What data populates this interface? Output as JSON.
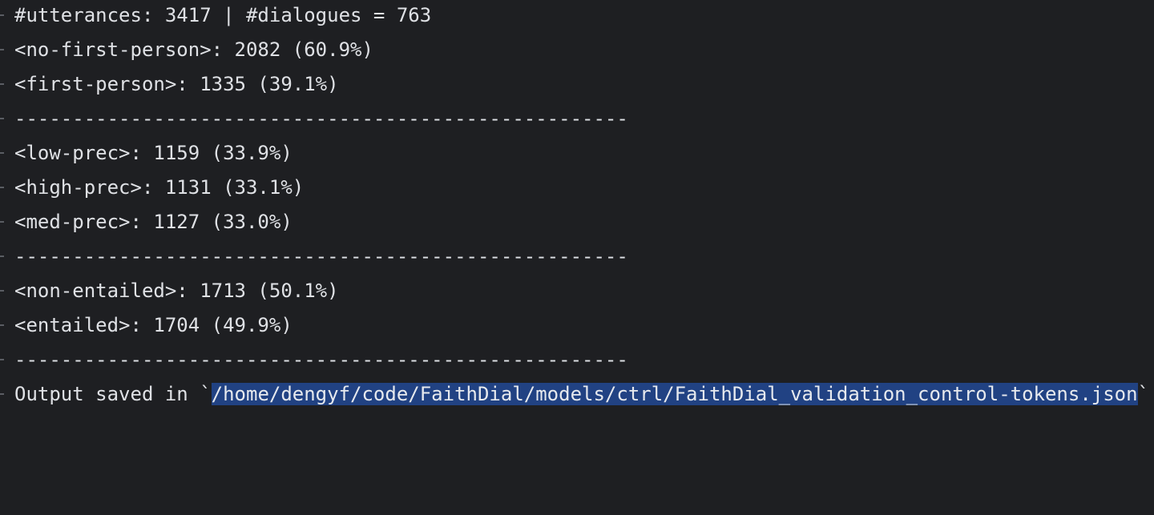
{
  "console": {
    "stats_line": "#utterances: 3417 | #dialogues = 763",
    "no_first_person": "<no-first-person>: 2082 (60.9%)",
    "first_person": "<first-person>: 1335 (39.1%)",
    "separator": "-----------------------------------------------------",
    "low_prec": "<low-prec>: 1159 (33.9%)",
    "high_prec": "<high-prec>: 1131 (33.1%)",
    "med_prec": "<med-prec>: 1127 (33.0%)",
    "non_entailed": "<non-entailed>: 1713 (50.1%)",
    "entailed": "<entailed>: 1704 (49.9%)",
    "output_prefix": "Output saved in `",
    "output_path": "/home/dengyf/code/FaithDial/models/ctrl/FaithDial_validation_control-tokens.json",
    "output_suffix": "`"
  }
}
